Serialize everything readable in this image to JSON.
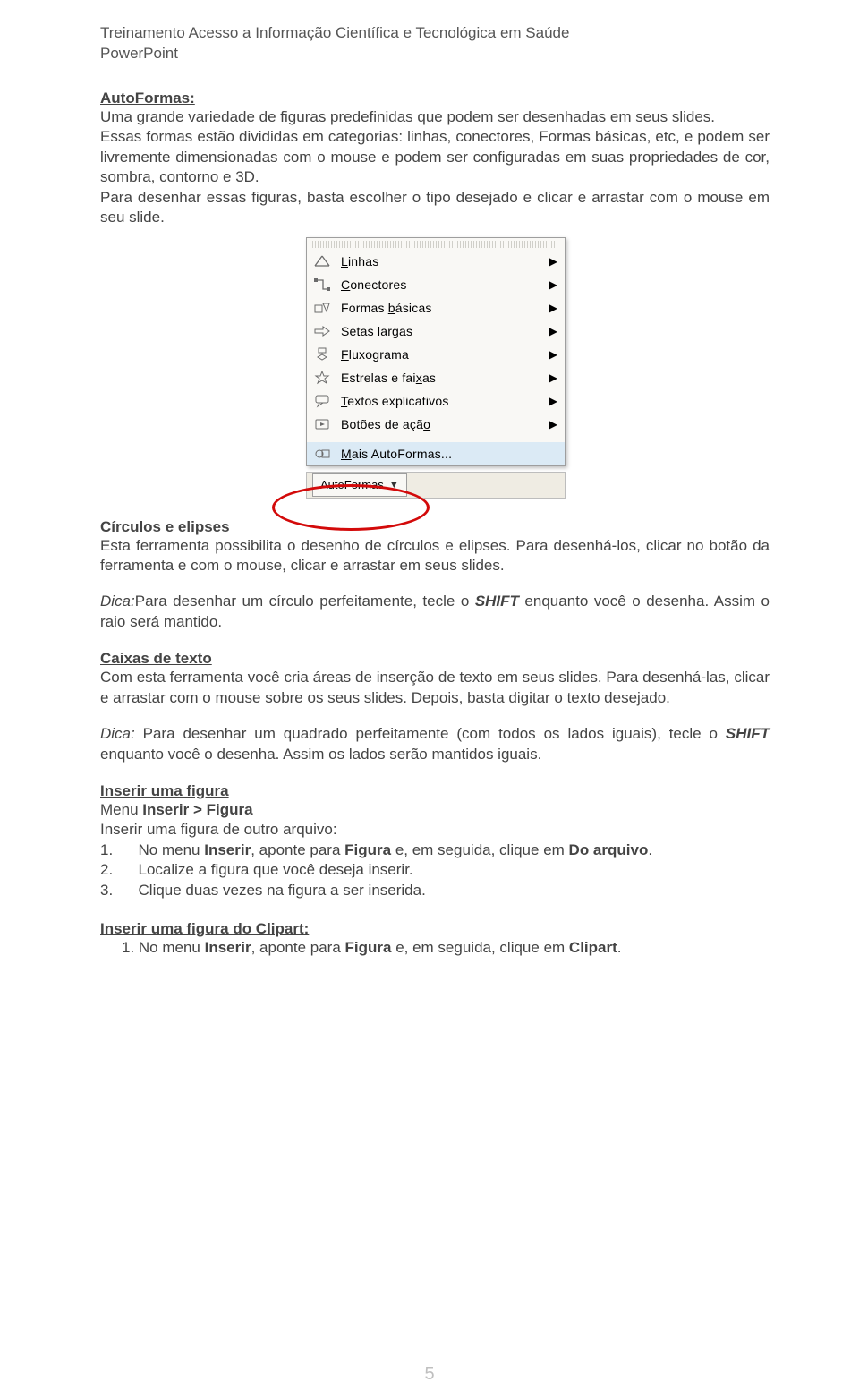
{
  "header": {
    "line1": "Treinamento Acesso a Informação Científica e Tecnológica em Saúde",
    "line2": "PowerPoint"
  },
  "autoformas": {
    "title": "AutoFormas:",
    "p1": "Uma grande variedade de figuras predefinidas que podem ser desenhadas em seus slides.",
    "p2": "Essas formas estão divididas em categorias: linhas, conectores, Formas básicas, etc, e podem ser livremente dimensionadas com o mouse e podem ser configuradas em suas propriedades de cor, sombra, contorno e 3D.",
    "p3": "Para desenhar essas figuras, basta escolher o tipo desejado e clicar e arrastar com o mouse em seu slide."
  },
  "menu": {
    "items": [
      {
        "label_pre": "",
        "u": "L",
        "label": "inhas",
        "arrow": true
      },
      {
        "label_pre": "",
        "u": "C",
        "label": "onectores",
        "arrow": true
      },
      {
        "label_pre": "Formas ",
        "u": "b",
        "label": "ásicas",
        "arrow": true
      },
      {
        "label_pre": "",
        "u": "S",
        "label": "etas largas",
        "arrow": true
      },
      {
        "label_pre": "",
        "u": "F",
        "label": "luxograma",
        "arrow": true
      },
      {
        "label_pre": "Estrelas e fai",
        "u": "x",
        "label": "as",
        "arrow": true
      },
      {
        "label_pre": "",
        "u": "T",
        "label": "extos explicativos",
        "arrow": true
      },
      {
        "label_pre": "Botões de açã",
        "u": "o",
        "label": "",
        "arrow": true
      },
      {
        "label_pre": "",
        "u": "M",
        "label": "ais AutoFormas...",
        "arrow": false
      }
    ],
    "autoformas_btn_pre": "A",
    "autoformas_btn_u": "u",
    "autoformas_btn_post": "toFormas"
  },
  "circulos": {
    "title": "Círculos e elipses",
    "p1": "Esta ferramenta possibilita o desenho de círculos e elipses. Para desenhá-los, clicar no botão da ferramenta e com o mouse, clicar e arrastar em seus slides.",
    "dica_lead": "Dica:",
    "dica_p1a": "Para desenhar um círculo perfeitamente, tecle o ",
    "dica_shift": "SHIFT",
    "dica_p1b": " enquanto você o desenha. Assim o raio será mantido."
  },
  "caixas": {
    "title": "Caixas de texto",
    "p1": "Com esta ferramenta você cria áreas de inserção de texto em seus slides. Para desenhá-las, clicar e arrastar com o mouse sobre os seus slides. Depois, basta digitar o texto desejado.",
    "dica_lead": "Dica:",
    "dica_a": " Para desenhar um quadrado perfeitamente (com todos os lados iguais), tecle o ",
    "dica_shift": "SHIFT",
    "dica_b": " enquanto você o desenha. Assim os lados serão mantidos iguais."
  },
  "inserir_figura": {
    "title": "Inserir uma figura",
    "menupath_a": "Menu ",
    "menupath_b": "Inserir > Figura",
    "sub": "Inserir uma figura de outro arquivo:",
    "step1a": "1.      No menu ",
    "step1b": "Inserir",
    "step1c": ", aponte para ",
    "step1d": "Figura",
    "step1e": " e, em seguida, clique em ",
    "step1f": "Do arquivo",
    "step1g": ".",
    "step2": "2.      Localize a figura que você deseja inserir.",
    "step3": "3.      Clique duas vezes na figura a ser inserida."
  },
  "inserir_clipart": {
    "title": "Inserir uma figura do Clipart:",
    "s1a": "1. No menu ",
    "s1b": "Inserir",
    "s1c": ", aponte para ",
    "s1d": "Figura",
    "s1e": " e, em seguida, clique em ",
    "s1f": "Clipart",
    "s1g": "."
  },
  "page_number": "5"
}
